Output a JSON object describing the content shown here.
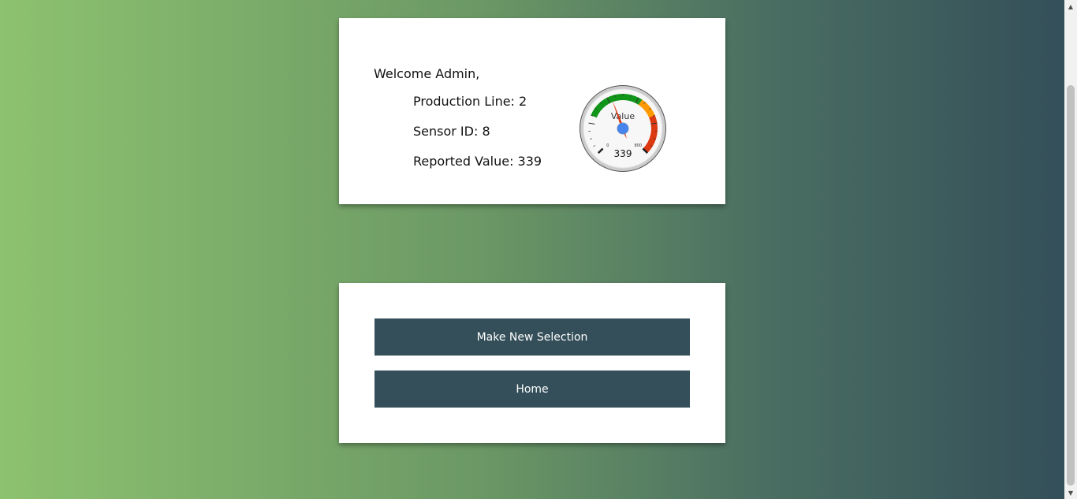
{
  "welcome": {
    "greeting": "Welcome Admin,"
  },
  "info": {
    "production_line": "Production Line: 2",
    "sensor_id": "Sensor ID: 8",
    "reported_value": "Reported Value: 339"
  },
  "gauge": {
    "label": "Value",
    "value": 339,
    "value_text": "339",
    "min": 0,
    "max": 800,
    "min_label": "0",
    "max_label": "800",
    "zones": [
      {
        "from": 0,
        "to": 200,
        "color": "#ffffff"
      },
      {
        "from": 200,
        "to": 500,
        "color": "#109618"
      },
      {
        "from": 500,
        "to": 600,
        "color": "#ff9900"
      },
      {
        "from": 600,
        "to": 800,
        "color": "#dc3912"
      }
    ],
    "needle_color": "#dc3912",
    "hub_color": "#4684ee"
  },
  "actions": {
    "new_selection_label": "Make New Selection",
    "home_label": "Home"
  },
  "colors": {
    "button_bg": "#344f59",
    "gradient_start": "#8dc26f",
    "gradient_end": "#344f59"
  }
}
